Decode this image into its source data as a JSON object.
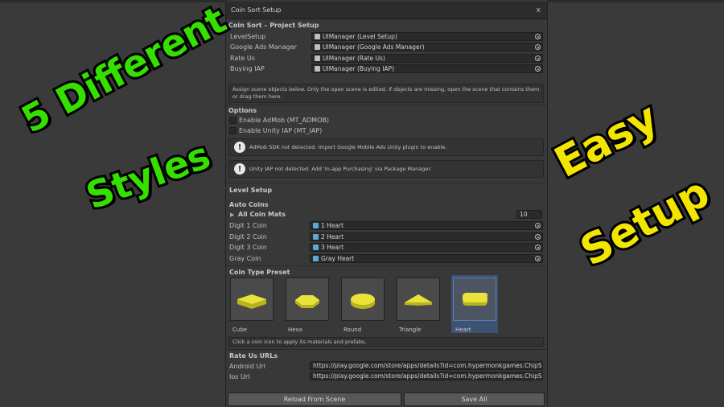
{
  "window": {
    "title": "Coin Sort Setup",
    "close": "x"
  },
  "project_setup": {
    "header": "Coin Sort – Project Setup",
    "rows": [
      {
        "label": "LevelSetup",
        "value": "UIManager (Level Setup)"
      },
      {
        "label": "Google Ads Manager",
        "value": "UIManager (Google Ads Manager)"
      },
      {
        "label": "Rate Us",
        "value": "UIManager (Rate Us)"
      },
      {
        "label": "Buying IAP",
        "value": "UIManager (Buying IAP)"
      }
    ],
    "help": "Assign scene objects below. Only the open scene is edited. If objects are missing, open the scene that contains them or drag them here."
  },
  "options": {
    "header": "Options",
    "admob_label": "Enable AdMob (MT_ADMOB)",
    "iap_label": "Enable Unity IAP (MT_IAP)",
    "admob_warning": "AdMob SDK not detected. Import Google Mobile Ads Unity plugin to enable.",
    "iap_warning": "Unity IAP not detected. Add 'In-app Purchasing' via Package Manager."
  },
  "level_setup": {
    "header": "Level Setup",
    "auto_coins": "Auto Coins",
    "all_coin_mats": "All Coin Mats",
    "all_coin_mats_count": "10",
    "digits": [
      {
        "label": "Digit 1 Coin",
        "value": "1 Heart"
      },
      {
        "label": "Digit 2 Coin",
        "value": "2 Heart"
      },
      {
        "label": "Digit 3 Coin",
        "value": "3 Heart"
      },
      {
        "label": "Gray Coin",
        "value": "Gray Heart"
      }
    ]
  },
  "coin_type_preset": {
    "header": "Coin Type Preset",
    "items": [
      {
        "label": "Cube",
        "selected": false
      },
      {
        "label": "Hexa",
        "selected": false
      },
      {
        "label": "Round",
        "selected": false
      },
      {
        "label": "Triangle",
        "selected": false
      },
      {
        "label": "Heart",
        "selected": true
      }
    ],
    "hint": "Click a coin icon to apply its materials and prefabs."
  },
  "rate_us": {
    "header": "Rate Us URLs",
    "android_label": "Android Url",
    "android_value": "https://play.google.com/store/apps/details?id=com.hypermonkgames.ChipS",
    "ios_label": "Ios Url",
    "ios_value": "https://play.google.com/store/apps/details?id=com.hypermonkgames.ChipS"
  },
  "buttons": {
    "reload": "Reload From Scene",
    "save": "Save All"
  },
  "overlay": {
    "left_line1": "5 Different",
    "left_line2": "Styles",
    "right_line1": "Easy",
    "right_line2": "Setup"
  },
  "colors": {
    "overlay_green": "#35e000",
    "overlay_yellow": "#f2e600",
    "coin_yellow": "#e8e23a",
    "selection_blue": "#3e5273"
  }
}
